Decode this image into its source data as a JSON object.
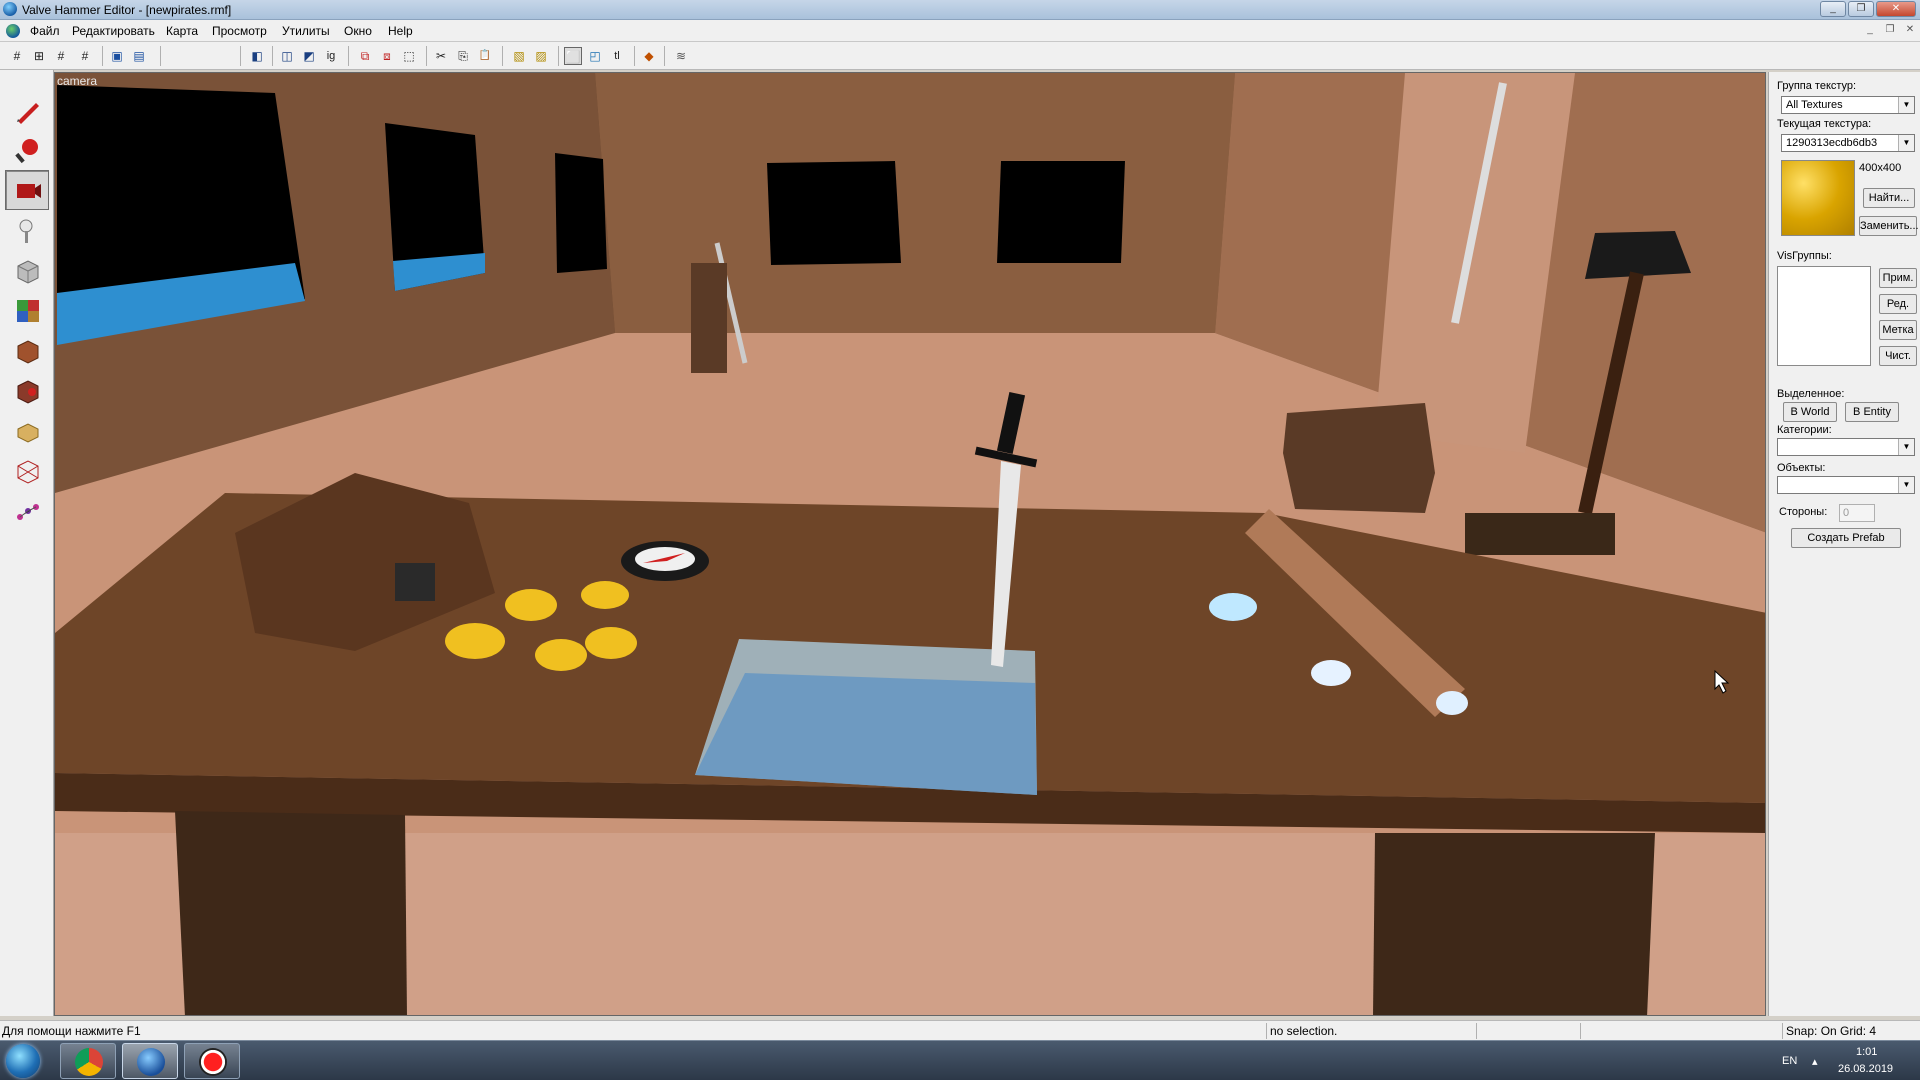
{
  "window": {
    "title": "Valve Hammer Editor - [newpirates.rmf]"
  },
  "window_controls": {
    "minimize": "_",
    "restore": "❐",
    "close": "✕"
  },
  "menu": [
    "Файл",
    "Редактировать",
    "Карта",
    "Просмотр",
    "Утилиты",
    "Окно",
    "Help"
  ],
  "mdi_controls": {
    "minimize": "_",
    "restore": "❐",
    "close": "✕"
  },
  "toolbar": [
    {
      "name": "grid-toggle-icon",
      "glyph": "#"
    },
    {
      "name": "grid-3d-icon",
      "glyph": "⊞"
    },
    {
      "name": "grid-smaller-icon",
      "glyph": "#"
    },
    {
      "name": "grid-larger-icon",
      "glyph": "#"
    },
    {
      "name": "group-icon",
      "glyph": "▣"
    },
    {
      "name": "ungroup-icon",
      "glyph": "▤"
    },
    {
      "name": "load-window-state-icon",
      "glyph": "◧"
    },
    {
      "name": "hide-selected-icon",
      "glyph": "◫"
    },
    {
      "name": "hide-unselected-icon",
      "glyph": "◩"
    },
    {
      "name": "ignore-group-icon",
      "glyph": "ig"
    },
    {
      "name": "carve-icon",
      "glyph": "⧉"
    },
    {
      "name": "hollow-icon",
      "glyph": "⧈"
    },
    {
      "name": "make-solid-icon",
      "glyph": "⬚"
    },
    {
      "name": "cut-icon",
      "glyph": "✂"
    },
    {
      "name": "copy-icon",
      "glyph": "⎘"
    },
    {
      "name": "paste-icon",
      "glyph": "📋"
    },
    {
      "name": "texture-lock-icon",
      "glyph": "▧"
    },
    {
      "name": "texture-scale-lock-icon",
      "glyph": "▨"
    },
    {
      "name": "selection-box-icon",
      "glyph": "⬜"
    },
    {
      "name": "select-by-handles-icon",
      "glyph": "◰"
    },
    {
      "name": "tie-to-entity-icon",
      "glyph": "tl"
    },
    {
      "name": "run-map-icon",
      "glyph": "◆"
    },
    {
      "name": "entity-report-icon",
      "glyph": "≋"
    }
  ],
  "tools": [
    "selection-tool-icon",
    "magnify-tool-icon",
    "camera-tool-icon",
    "entity-tool-icon",
    "block-tool-icon",
    "texture-tool-icon",
    "apply-texture-icon",
    "decal-tool-icon",
    "overlay-tool-icon",
    "clip-tool-icon",
    "vertex-tool-icon",
    "path-tool-icon"
  ],
  "viewport": {
    "label": "camera"
  },
  "panel": {
    "texture_group_label": "Группа текстур:",
    "texture_group_value": "All Textures",
    "current_texture_label": "Текущая текстура:",
    "current_texture_value": "1290313ecdb6db3",
    "texture_size": "400x400",
    "find_button": "Найти...",
    "replace_button": "Заменить...",
    "visgroups_label": "VisГруппы:",
    "apply_button": "Прим.",
    "edit_button": "Ред.",
    "mark_button": "Метка",
    "purge_button": "Чист.",
    "selected_label": "Выделенное:",
    "to_world_button": "В World",
    "to_entity_button": "В Entity",
    "categories_label": "Категории:",
    "objects_label": "Объекты:",
    "faces_label": "Стороны:",
    "faces_value": "0",
    "create_prefab_button": "Создать Prefab"
  },
  "status": {
    "help": "Для помощи нажмите F1",
    "selection": "no selection.",
    "snap": "Snap: On Grid: 4"
  },
  "taskbar": {
    "language": "EN",
    "time": "1:01",
    "date": "26.08.2019"
  }
}
